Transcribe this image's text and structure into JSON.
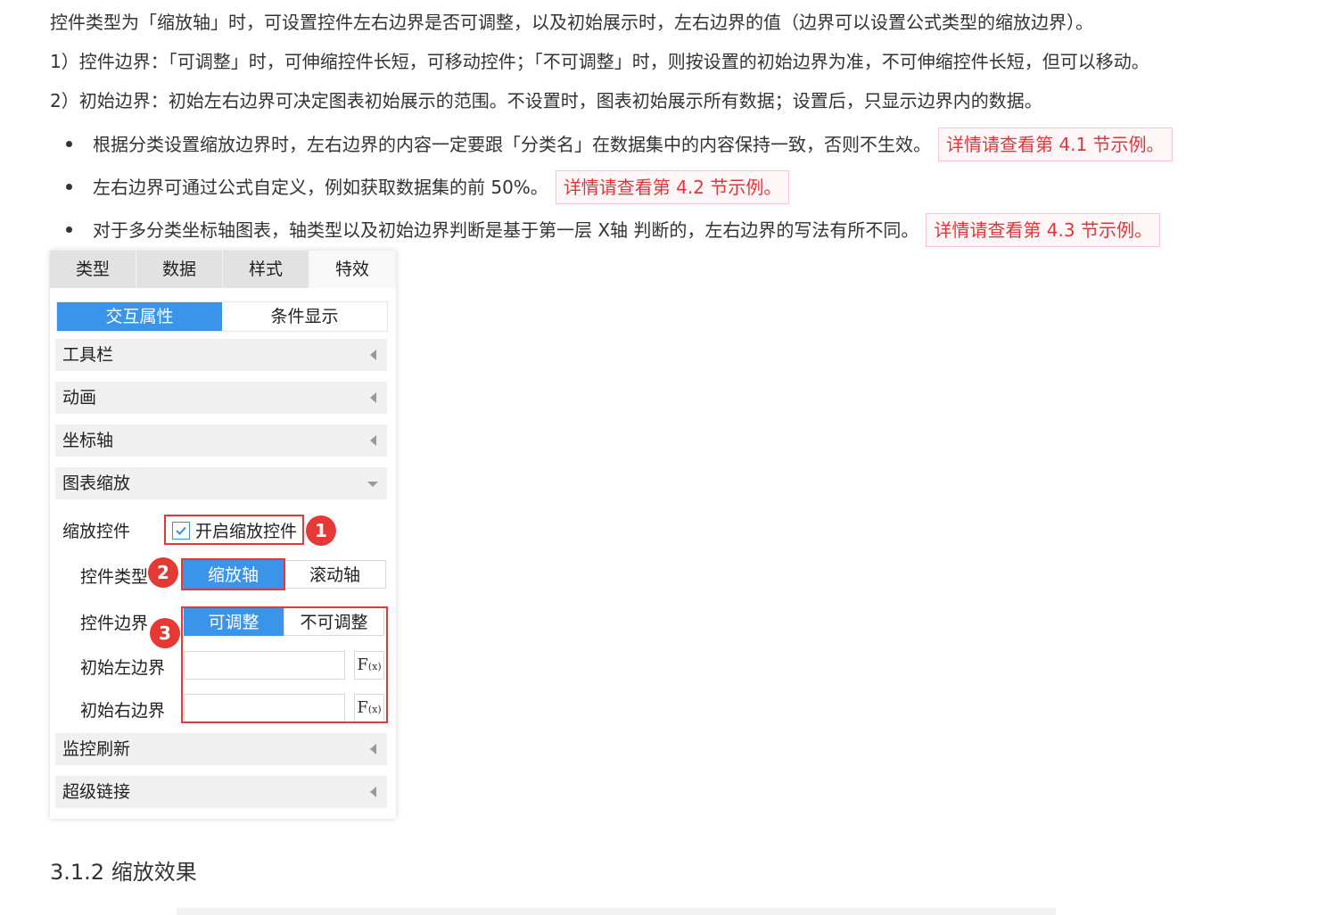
{
  "doc": {
    "p1": "控件类型为「缩放轴」时，可设置控件左右边界是否可调整，以及初始展示时，左右边界的值（边界可以设置公式类型的缩放边界）。",
    "p2": "1）控件边界：「可调整」时，可伸缩控件长短，可移动控件；「不可调整」时，则按设置的初始边界为准，不可伸缩控件长短，但可以移动。",
    "p3": "2）初始边界：初始左右边界可决定图表初始展示的范围。不设置时，图表初始展示所有数据；设置后，只显示边界内的数据。",
    "bullets": [
      {
        "text": "根据分类设置缩放边界时，左右边界的内容一定要跟「分类名」在数据集中的内容保持一致，否则不生效。",
        "link": "详情请查看第 4.1 节示例。"
      },
      {
        "text": "左右边界可通过公式自定义，例如获取数据集的前 50%。",
        "link": "详情请查看第 4.2 节示例。"
      },
      {
        "text": "对于多分类坐标轴图表，轴类型以及初始边界判断是基于第一层 X轴 判断的，左右边界的写法有所不同。",
        "link": "详情请查看第 4.3 节示例。"
      }
    ],
    "heading": "3.1.2 缩放效果"
  },
  "panel": {
    "tabs": [
      "类型",
      "数据",
      "样式",
      "特效"
    ],
    "sub_tabs": [
      "交互属性",
      "条件显示"
    ],
    "sections": {
      "toolbar": "工具栏",
      "animation": "动画",
      "axis": "坐标轴",
      "zoom": "图表缩放",
      "monitor": "监控刷新",
      "hyperlink": "超级链接"
    },
    "zoom_control_label": "缩放控件",
    "enable_zoom_label": "开启缩放控件",
    "control_type_label": "控件类型",
    "control_type_options": [
      "缩放轴",
      "滚动轴"
    ],
    "control_boundary_label": "控件边界",
    "boundary_options": [
      "可调整",
      "不可调整"
    ],
    "initial_left_label": "初始左边界",
    "initial_right_label": "初始右边界",
    "fx_label": "F",
    "fx_sub": "(x)",
    "initial_left_value": "",
    "initial_right_value": "",
    "badges": [
      "1",
      "2",
      "3"
    ]
  },
  "colors": {
    "accent_blue": "#3a94ea",
    "highlight_red": "#e53935",
    "link_red": "#e0353a"
  }
}
